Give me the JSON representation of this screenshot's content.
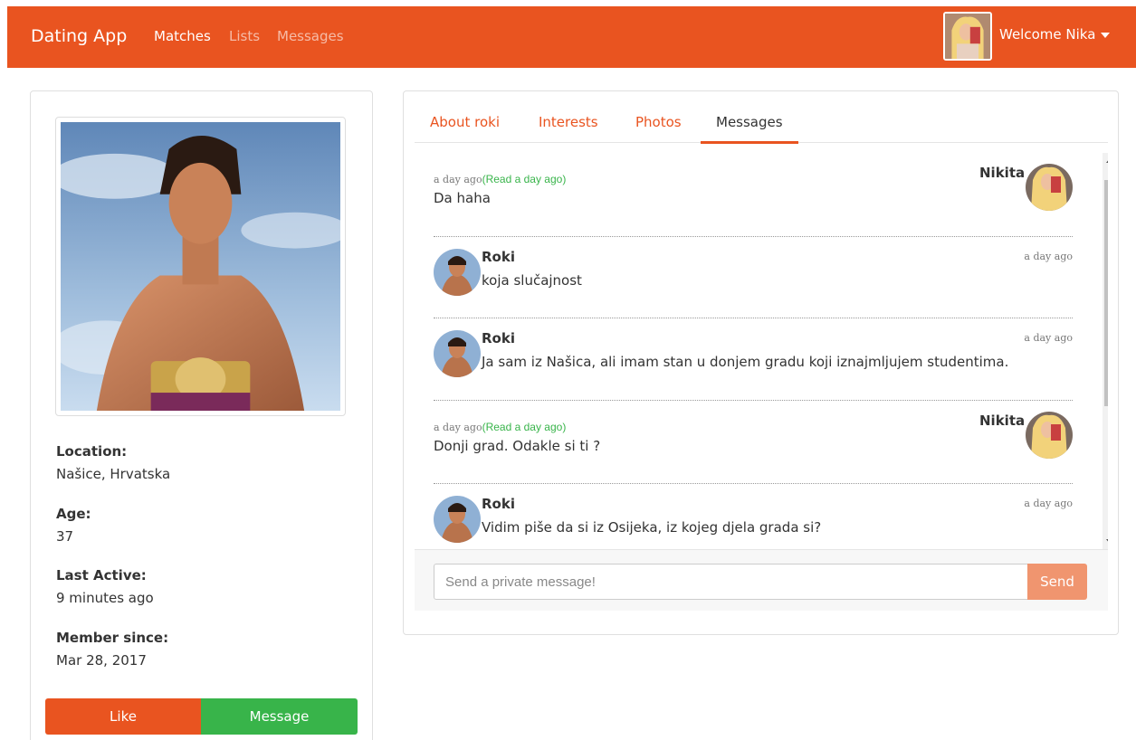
{
  "navbar": {
    "brand": "Dating App",
    "links": [
      "Matches",
      "Lists",
      "Messages"
    ],
    "welcome": "Welcome Nika"
  },
  "profile": {
    "location_label": "Location:",
    "location": "Našice, Hrvatska",
    "age_label": "Age:",
    "age": "37",
    "last_active_label": "Last Active:",
    "last_active": "9 minutes ago",
    "member_since_label": "Member since:",
    "member_since": "Mar 28, 2017",
    "like_label": "Like",
    "message_label": "Message"
  },
  "tabs": [
    "About roki",
    "Interests",
    "Photos",
    "Messages"
  ],
  "messages": [
    {
      "sender": "Nikita",
      "time": "a day ago",
      "read": "(Read a day ago)",
      "text": "Da haha"
    },
    {
      "sender": "Roki",
      "time": "a day ago",
      "text": "koja slučajnost"
    },
    {
      "sender": "Roki",
      "time": "a day ago",
      "text": "Ja sam iz Našica, ali imam stan u donjem gradu koji iznajmljujem studentima."
    },
    {
      "sender": "Nikita",
      "time": "a day ago",
      "read": "(Read a day ago)",
      "text": "Donji grad. Odakle si ti ?"
    },
    {
      "sender": "Roki",
      "time": "a day ago",
      "text": "Vidim piše da si iz Osijeka, iz kojeg djela grada si?"
    }
  ],
  "composer": {
    "placeholder": "Send a private message!",
    "send_label": "Send"
  },
  "colors": {
    "primary": "#e95420",
    "success": "#38b44a",
    "send_disabled": "#f0956f"
  }
}
